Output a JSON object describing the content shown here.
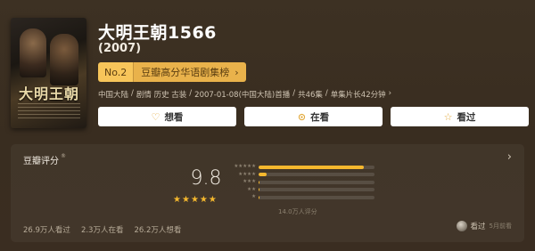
{
  "movie": {
    "title": "大明王朝1566",
    "year": "(2007)",
    "poster_title": "大明王朝",
    "rank": {
      "number": "No.2",
      "label": "豆瓣高分华语剧集榜"
    },
    "meta": [
      "中国大陆",
      "/",
      "剧情 历史 古装",
      "/",
      "2007-01-08(中国大陆)首播",
      "/",
      "共46集",
      "/",
      "单集片长42分钟",
      "›"
    ]
  },
  "buttons": [
    {
      "label": "想看",
      "icon": "heart-plus-icon"
    },
    {
      "label": "在看",
      "icon": "play-circle-icon"
    },
    {
      "label": "看过",
      "icon": "star-outline-icon"
    }
  ],
  "rating": {
    "title": "豆瓣评分",
    "reg_mark": "®",
    "score": "9.8",
    "stars": 5,
    "distribution": [
      {
        "stars": 5,
        "fraction": 0.91
      },
      {
        "stars": 4,
        "fraction": 0.07
      },
      {
        "stars": 3,
        "fraction": 0.01
      },
      {
        "stars": 2,
        "fraction": 0.005
      },
      {
        "stars": 1,
        "fraction": 0.005
      }
    ],
    "count_text": "14.0万人评分"
  },
  "stats": {
    "watched": "26.9万人看过",
    "watching": "2.3万人在看",
    "wish": "26.2万人想看"
  },
  "user": {
    "status": "看过",
    "date": "5月前看"
  },
  "colors": {
    "accent": "#f5b82e",
    "rank_badge": "#e9b24b",
    "background": "#3b2f22"
  }
}
